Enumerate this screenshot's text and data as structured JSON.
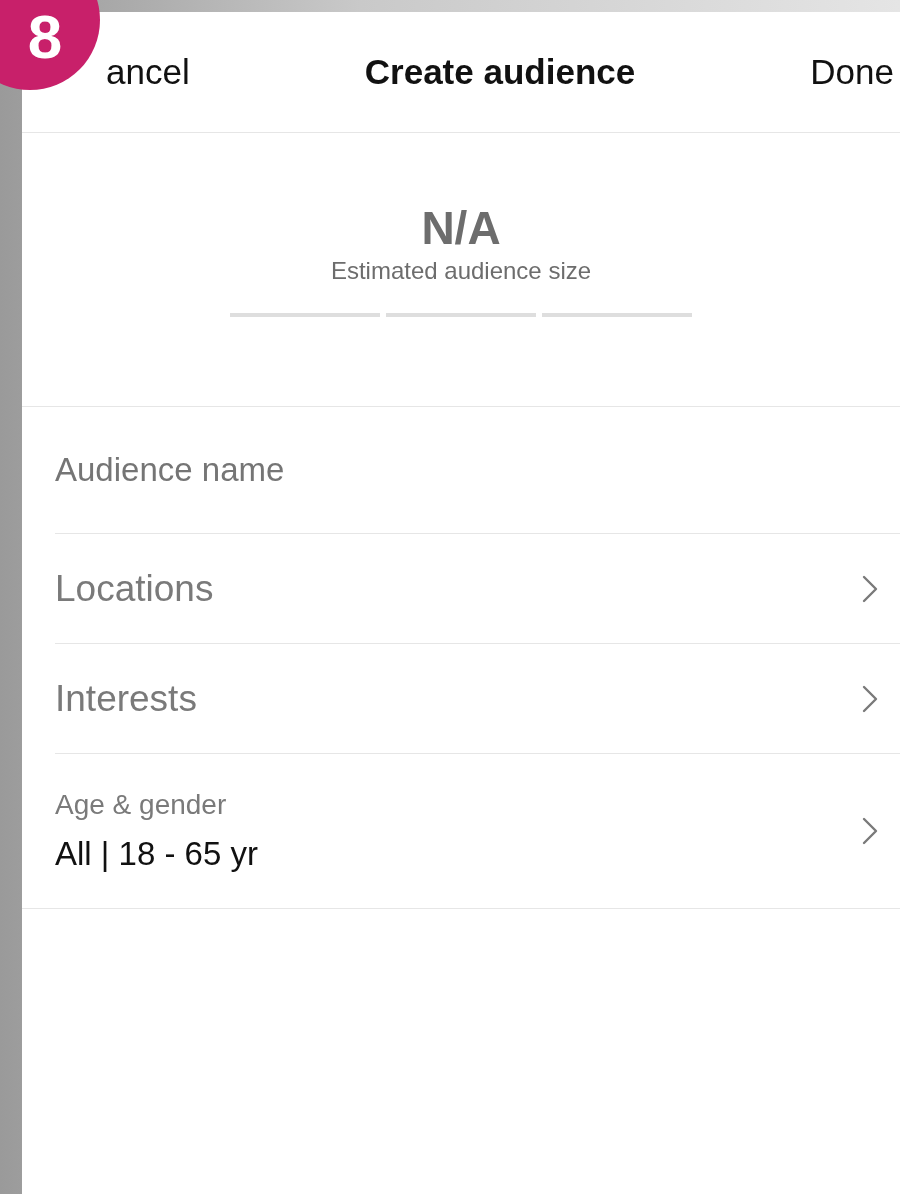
{
  "badge": {
    "text": "8"
  },
  "nav": {
    "cancel": "ancel",
    "title": "Create audience",
    "done": "Done"
  },
  "estimate": {
    "value": "N/A",
    "caption": "Estimated audience size"
  },
  "name_field": {
    "placeholder": "Audience name"
  },
  "rows": [
    {
      "kind": "link",
      "label": "Locations"
    },
    {
      "kind": "link",
      "label": "Interests"
    },
    {
      "kind": "detail",
      "label": "Age & gender",
      "value": "All | 18 - 65 yr"
    }
  ]
}
